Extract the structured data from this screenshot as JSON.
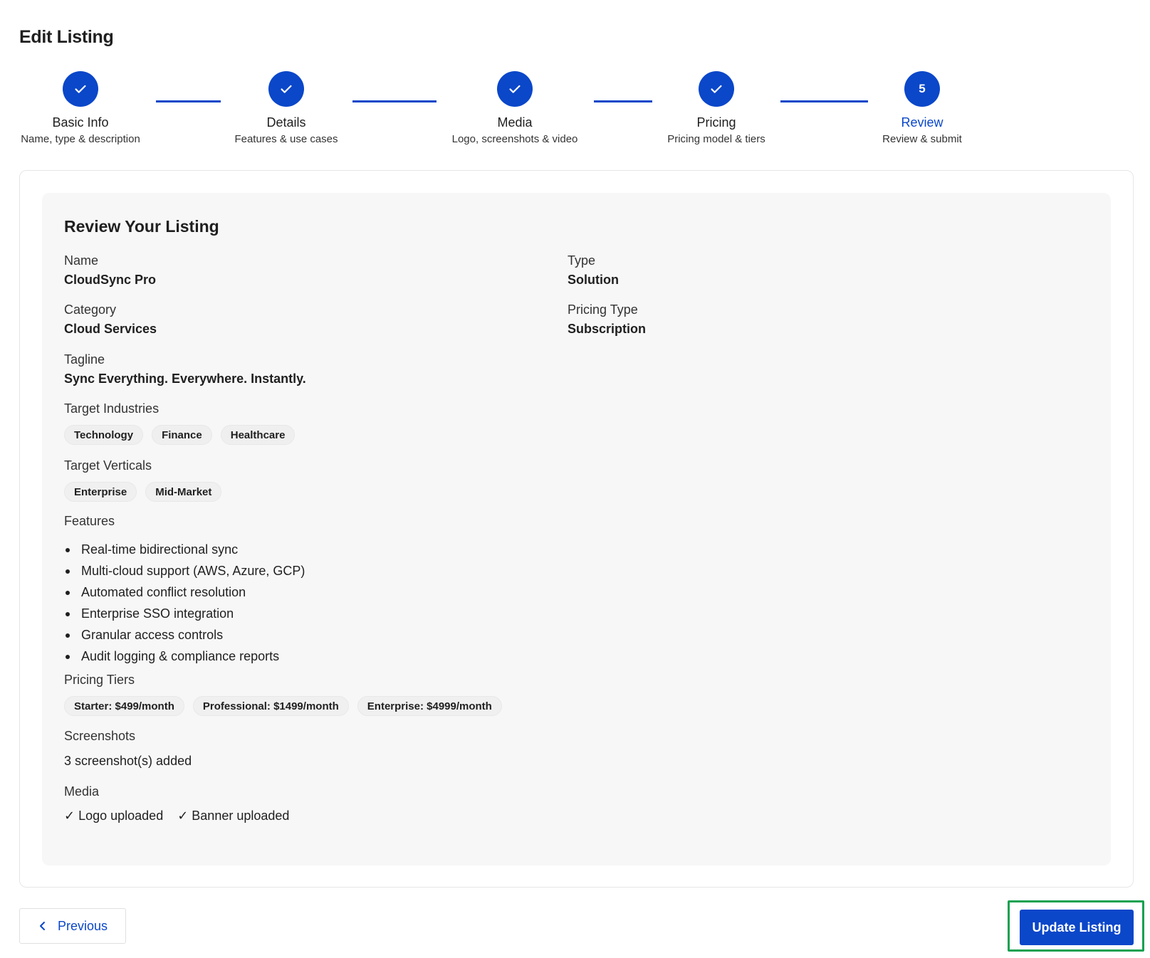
{
  "page": {
    "title": "Edit Listing"
  },
  "stepper": {
    "steps": [
      {
        "label": "Basic Info",
        "sub": "Name, type & description",
        "state": "complete",
        "icon": "check-icon"
      },
      {
        "label": "Details",
        "sub": "Features & use cases",
        "state": "complete",
        "icon": "check-icon"
      },
      {
        "label": "Media",
        "sub": "Logo, screenshots & video",
        "state": "complete",
        "icon": "check-icon"
      },
      {
        "label": "Pricing",
        "sub": "Pricing model & tiers",
        "state": "complete",
        "icon": "check-icon"
      },
      {
        "label": "Review",
        "sub": "Review & submit",
        "state": "active",
        "number": "5"
      }
    ]
  },
  "review": {
    "title": "Review Your Listing",
    "name": {
      "label": "Name",
      "value": "CloudSync Pro"
    },
    "type": {
      "label": "Type",
      "value": "Solution"
    },
    "category": {
      "label": "Category",
      "value": "Cloud Services"
    },
    "pricing_type": {
      "label": "Pricing Type",
      "value": "Subscription"
    },
    "tagline": {
      "label": "Tagline",
      "value": "Sync Everything. Everywhere. Instantly."
    },
    "target_industries": {
      "label": "Target Industries",
      "items": [
        "Technology",
        "Finance",
        "Healthcare"
      ]
    },
    "target_verticals": {
      "label": "Target Verticals",
      "items": [
        "Enterprise",
        "Mid-Market"
      ]
    },
    "features": {
      "label": "Features",
      "items": [
        "Real-time bidirectional sync",
        "Multi-cloud support (AWS, Azure, GCP)",
        "Automated conflict resolution",
        "Enterprise SSO integration",
        "Granular access controls",
        "Audit logging & compliance reports"
      ]
    },
    "pricing_tiers": {
      "label": "Pricing Tiers",
      "items": [
        "Starter: $499/month",
        "Professional: $1499/month",
        "Enterprise: $4999/month"
      ]
    },
    "screenshots": {
      "label": "Screenshots",
      "value": "3 screenshot(s) added"
    },
    "media": {
      "label": "Media",
      "items": [
        "✓ Logo uploaded",
        "✓ Banner uploaded"
      ]
    }
  },
  "actions": {
    "previous_label": "Previous",
    "update_label": "Update Listing"
  },
  "colors": {
    "primary": "#0a47c9",
    "highlight": "#12a150",
    "panel": "#f7f7f7"
  }
}
